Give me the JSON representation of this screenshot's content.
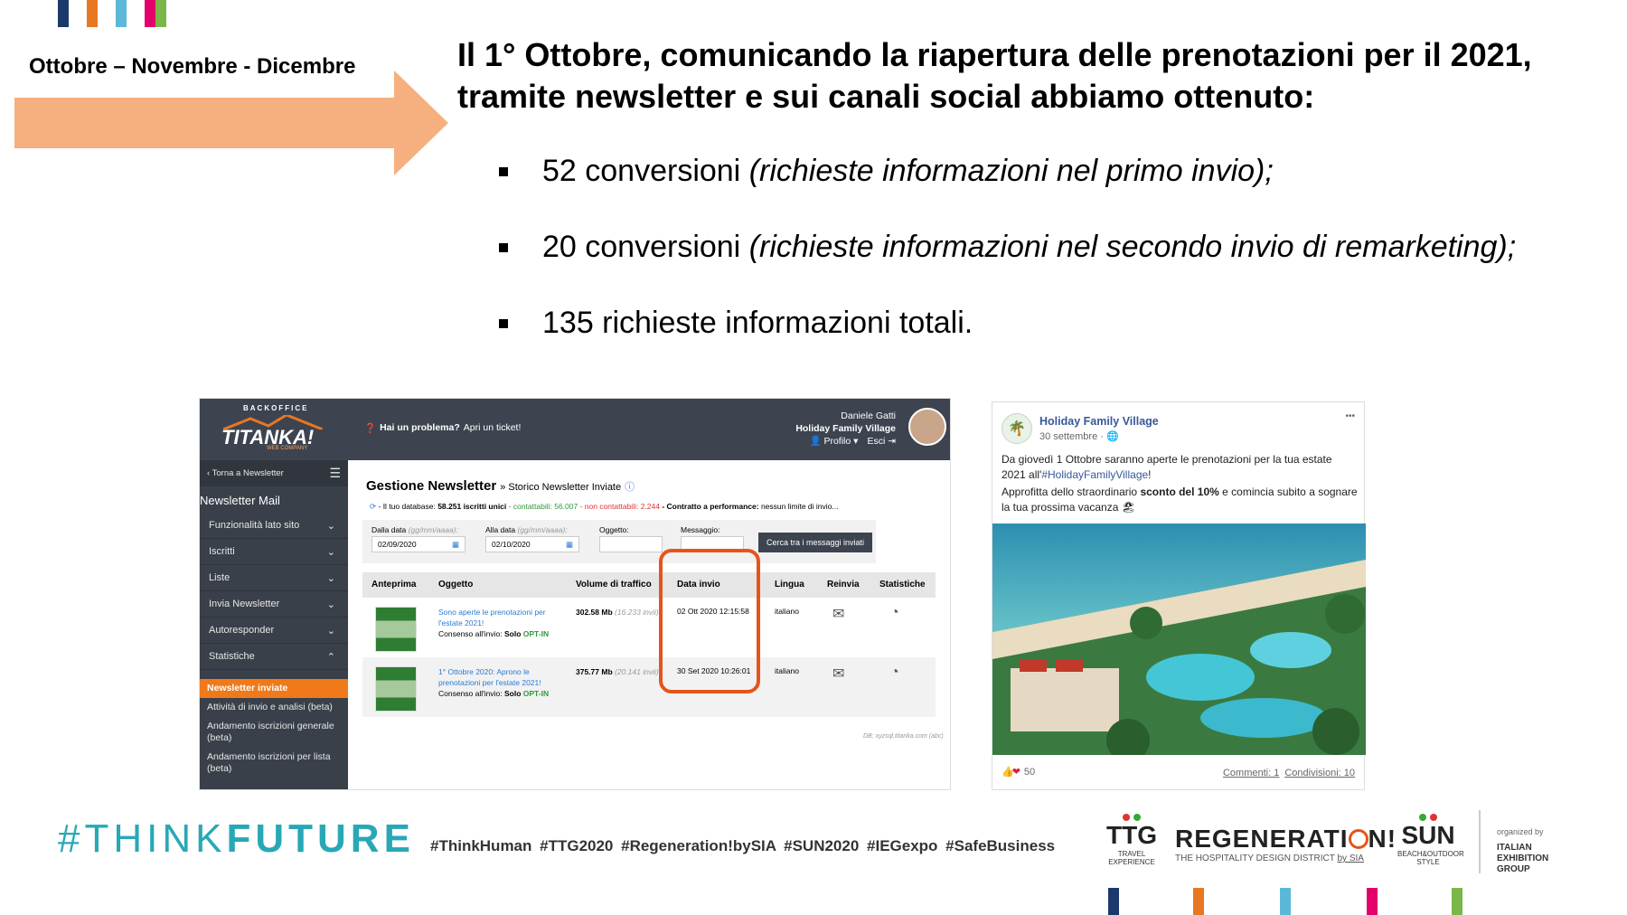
{
  "top_bar_colors": [
    "#1b3a6b",
    "#e87722",
    "#5bb8d8",
    "#e2006a",
    "#7ab648"
  ],
  "bottom_bar_colors": [
    "#1b3a6b",
    "#e87722",
    "#5bb8d8",
    "#e2006a",
    "#7ab648"
  ],
  "arrow_color": "#f6b07f",
  "period": "Ottobre – Novembre - Dicembre",
  "headline": "Il 1° Ottobre, comunicando la riapertura delle prenotazioni per il 2021, tramite newsletter e sui canali social abbiamo ottenuto:",
  "bullets": [
    {
      "main": "52 conversioni",
      "note": "(richieste informazioni nel primo invio);"
    },
    {
      "main": "20 conversioni",
      "note": "(richieste informazioni nel secondo invio di remarketing);"
    },
    {
      "main": "135 richieste informazioni totali.",
      "note": ""
    }
  ],
  "backoffice": {
    "brand_top": "BACKOFFICE",
    "brand": "TITANKA!",
    "brand_sub": "WEB COMPANY",
    "help_text": "Hai un problema?",
    "help_link": "Apri un ticket!",
    "user_name": "Daniele Gatti",
    "user_company": "Holiday Family Village",
    "profile_label": "Profilo",
    "logout_label": "Esci",
    "back_label": "‹ Torna a Newsletter",
    "menu_title": "Newsletter Mail",
    "menu_items": [
      "Funzionalità lato sito",
      "Iscritti",
      "Liste",
      "Invia Newsletter",
      "Autoresponder",
      "Statistiche"
    ],
    "sub_items": [
      "Newsletter inviate",
      "Attività di invio e analisi (beta)",
      "Andamento iscrizioni generale (beta)",
      "Andamento iscrizioni per lista (beta)"
    ],
    "page_title": "Gestione Newsletter",
    "page_subtitle": "» Storico Newsletter Inviate",
    "db_prefix": "- Il tuo database:",
    "db_count": "58.251 iscritti unici",
    "db_contactable": "- contattabili: 56.007",
    "db_noncontactable": "- non contattabili: 2.244",
    "db_contract": "- Contratto a performance:",
    "db_limit": "nessun limite di invio...",
    "filter_from_label": "Dalla data",
    "filter_to_label": "Alla data",
    "filter_format": "(gg/mm/aaaa):",
    "filter_from_value": "02/09/2020",
    "filter_to_value": "02/10/2020",
    "filter_subject_label": "Oggetto:",
    "filter_message_label": "Messaggio:",
    "search_button": "Cerca tra i messaggi inviati",
    "columns": [
      "Anteprima",
      "Oggetto",
      "Volume di traffico",
      "Data invio",
      "Lingua",
      "Reinvia",
      "Statistiche"
    ],
    "rows": [
      {
        "subject": "Sono aperte le prenotazioni per l'estate 2021!",
        "consent_label": "Consenso all'invio:",
        "consent_prefix": "Solo",
        "consent_value": "OPT-IN",
        "volume": "302.58 Mb",
        "sends": "(16.233 invii)",
        "date": "02 Ott 2020 12:15:58",
        "lang": "italiano"
      },
      {
        "subject": "1° Ottobre 2020: Aprono le prenotazioni per l'estate 2021!",
        "consent_label": "Consenso all'invio:",
        "consent_prefix": "Solo",
        "consent_value": "OPT-IN",
        "volume": "375.77 Mb",
        "sends": "(20.141 invii)",
        "date": "30 Set 2020 10:26:01",
        "lang": "italiano"
      }
    ],
    "db_footer": "DB: xyzsql.titanka.com (abc)"
  },
  "facebook": {
    "page_name": "Holiday Family Village",
    "date": "30 settembre ·",
    "more": "•••",
    "text_1": "Da giovedì 1 Ottobre saranno aperte le prenotazioni per la tua estate 2021 all'",
    "hashtag": "#HolidayFamilyVillage",
    "text_1_end": "!",
    "text_2": "Approfitta dello straordinario",
    "text_2_bold": "sconto del 10%",
    "text_2_end": "e comincia subito a sognare la tua prossima vacanza",
    "reactions": "50",
    "comments": "Commenti: 1",
    "shares": "Condivisioni: 10"
  },
  "footer": {
    "think": "#THINK",
    "future": "FUTURE",
    "hashtags": "#ThinkHuman #TTG2020 #Regeneration!bySIA #SUN2020 #IEGexpo #SafeBusiness",
    "ttg": "TTG",
    "ttg_sub_1": "TRAVEL",
    "ttg_sub_2": "EXPERIENCE",
    "regen": "REGENERATI",
    "regen_end": "N!",
    "regen_sub": "THE HOSPITALITY DESIGN DISTRICT",
    "regen_by": "by SIA",
    "sun": "SUN",
    "sun_sub_1": "BEACH&OUTDOOR",
    "sun_sub_2": "STYLE",
    "organized": "organized by",
    "ieg_1": "ITALIAN",
    "ieg_2": "EXHIBITION",
    "ieg_3": "GROUP"
  }
}
